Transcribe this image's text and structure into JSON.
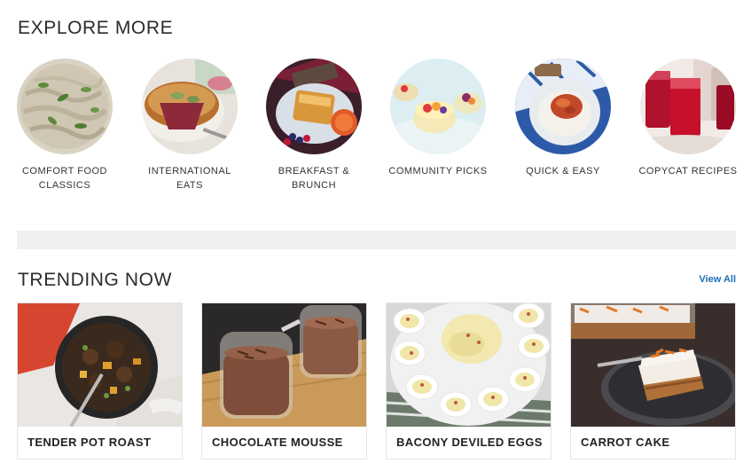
{
  "explore": {
    "title": "EXPLORE MORE",
    "categories": [
      {
        "label": "COMFORT FOOD CLASSICS",
        "icon": "comfort-food-photo"
      },
      {
        "label": "INTERNATIONAL EATS",
        "icon": "international-eats-photo"
      },
      {
        "label": "BREAKFAST & BRUNCH",
        "icon": "breakfast-brunch-photo"
      },
      {
        "label": "COMMUNITY PICKS",
        "icon": "community-picks-photo"
      },
      {
        "label": "QUICK & EASY",
        "icon": "quick-easy-photo"
      },
      {
        "label": "COPYCAT RECIPES",
        "icon": "copycat-recipes-photo"
      }
    ]
  },
  "trending": {
    "title": "TRENDING NOW",
    "view_all_label": "View All",
    "cards": [
      {
        "title": "TENDER POT ROAST"
      },
      {
        "title": "CHOCOLATE MOUSSE"
      },
      {
        "title": "BACONY DEVILED EGGS"
      },
      {
        "title": "CARROT CAKE"
      }
    ]
  },
  "colors": {
    "link": "#1a6fb5",
    "band": "#f0f0f0",
    "heading": "#2b2b2b"
  }
}
